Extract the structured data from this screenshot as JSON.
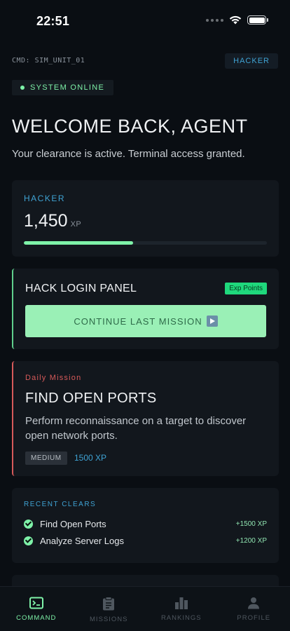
{
  "status_bar": {
    "time": "22:51"
  },
  "header": {
    "cmd_label": "CMD: SIM_UNIT_01",
    "role_badge": "HACKER",
    "system_status": "SYSTEM ONLINE"
  },
  "welcome": {
    "title": "WELCOME BACK, AGENT",
    "subtitle": "Your clearance is active. Terminal access granted."
  },
  "xp_card": {
    "role": "HACKER",
    "xp_value": "1,450",
    "xp_unit": "XP",
    "progress": 0.45
  },
  "current_mission": {
    "title": "HACK LOGIN PANEL",
    "badge": "Exp Points",
    "button_label": "CONTINUE LAST MISSION"
  },
  "daily_mission": {
    "label": "Daily Mission",
    "title": "FIND OPEN PORTS",
    "description": "Perform reconnaissance on a target to discover open network ports.",
    "difficulty": "MEDIUM",
    "xp": "1500 XP"
  },
  "recent_clears": {
    "label": "RECENT CLEARS",
    "items": [
      {
        "name": "Find Open Ports",
        "xp": "+1500 XP"
      },
      {
        "name": "Analyze Server Logs",
        "xp": "+1200 XP"
      }
    ]
  },
  "tabs": [
    {
      "label": "COMMAND",
      "icon": "terminal-icon",
      "active": true
    },
    {
      "label": "MISSIONS",
      "icon": "clipboard-icon",
      "active": false
    },
    {
      "label": "RANKINGS",
      "icon": "bar-chart-icon",
      "active": false
    },
    {
      "label": "PROFILE",
      "icon": "person-icon",
      "active": false
    }
  ],
  "colors": {
    "accent_green": "#7ef2a8",
    "accent_blue": "#3fa3d4",
    "danger_red": "#d65a5a",
    "background": "#0a0e13"
  }
}
